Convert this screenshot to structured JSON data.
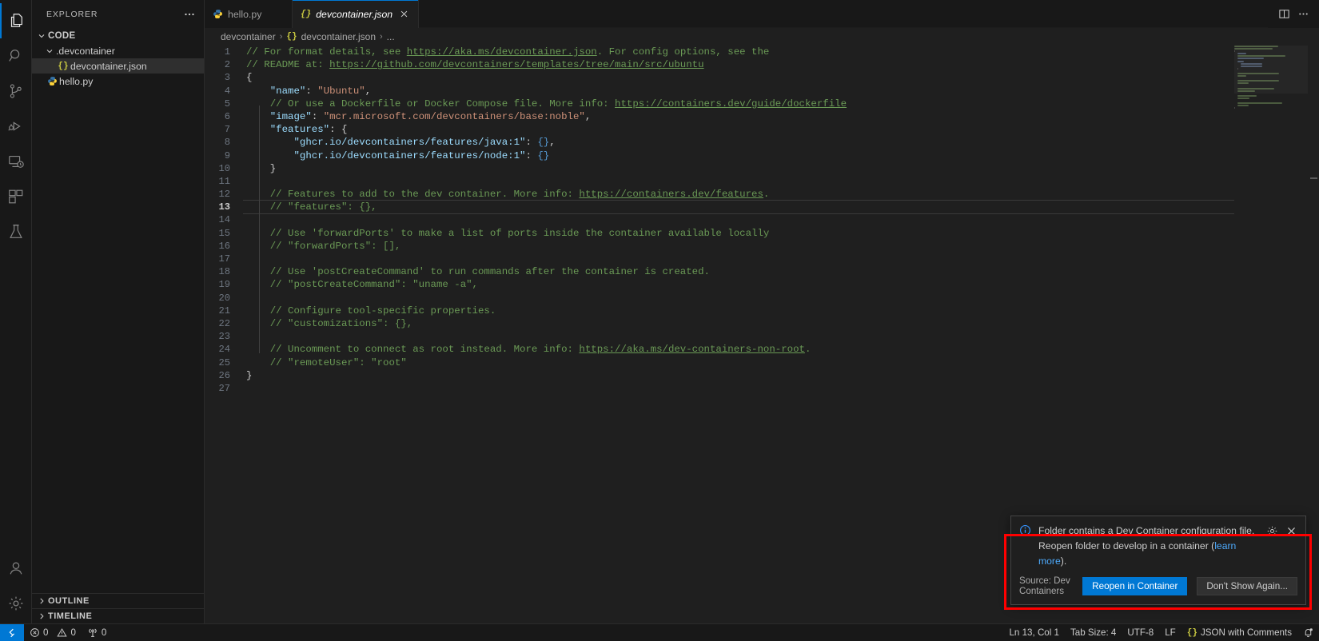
{
  "activitybar": {
    "items": [
      {
        "name": "explorer",
        "icon": "files-icon",
        "active": true
      },
      {
        "name": "search",
        "icon": "search-icon",
        "active": false
      },
      {
        "name": "source-control",
        "icon": "source-control-icon",
        "active": false
      },
      {
        "name": "run-and-debug",
        "icon": "run-debug-icon",
        "active": false
      },
      {
        "name": "remote-explorer",
        "icon": "remote-explorer-icon",
        "active": false
      },
      {
        "name": "extensions",
        "icon": "extensions-icon",
        "active": false
      },
      {
        "name": "testing",
        "icon": "testing-flask-icon",
        "active": false
      }
    ],
    "bottom": [
      {
        "name": "accounts",
        "icon": "account-icon"
      },
      {
        "name": "manage",
        "icon": "gear-icon"
      }
    ]
  },
  "sidebar": {
    "title": "EXPLORER",
    "actions": [
      "more-actions-icon"
    ],
    "tree": [
      {
        "label": "CODE",
        "level": 0,
        "kind": "folder-root",
        "expanded": true,
        "selected": false
      },
      {
        "label": ".devcontainer",
        "level": 1,
        "kind": "folder",
        "expanded": true,
        "selected": false
      },
      {
        "label": "devcontainer.json",
        "level": 2,
        "kind": "json",
        "expanded": null,
        "selected": true
      },
      {
        "label": "hello.py",
        "level": 1,
        "kind": "python",
        "expanded": null,
        "selected": false
      }
    ],
    "panels": [
      {
        "label": "OUTLINE",
        "expanded": false
      },
      {
        "label": "TIMELINE",
        "expanded": false
      }
    ]
  },
  "tabs": [
    {
      "label": "hello.py",
      "icon": "python-icon",
      "active": false,
      "closable": false
    },
    {
      "label": "devcontainer.json",
      "icon": "json-icon",
      "active": true,
      "closable": true
    }
  ],
  "editor_actions": [
    {
      "name": "split-editor-right",
      "icon": "split-editor-icon"
    },
    {
      "name": "more-editor-actions",
      "icon": "ellipsis-icon"
    }
  ],
  "breadcrumbs": [
    "devcontainer",
    "devcontainer.json",
    "..."
  ],
  "editor": {
    "current_line": 13,
    "total_lines": 27,
    "lines": [
      {
        "n": 1,
        "indent": 0,
        "segs": [
          {
            "t": "// For format details, see ",
            "c": "cmt"
          },
          {
            "t": "https://aka.ms/devcontainer.json",
            "c": "lnk"
          },
          {
            "t": ". For config options, see the",
            "c": "cmt"
          }
        ]
      },
      {
        "n": 2,
        "indent": 0,
        "segs": [
          {
            "t": "// README at: ",
            "c": "cmt"
          },
          {
            "t": "https://github.com/devcontainers/templates/tree/main/src/ubuntu",
            "c": "lnk"
          }
        ]
      },
      {
        "n": 3,
        "indent": 0,
        "segs": [
          {
            "t": "{",
            "c": "brc"
          }
        ]
      },
      {
        "n": 4,
        "indent": 1,
        "segs": [
          {
            "t": "\"name\"",
            "c": "key"
          },
          {
            "t": ": ",
            "c": "pun"
          },
          {
            "t": "\"Ubuntu\"",
            "c": "str"
          },
          {
            "t": ",",
            "c": "pun"
          }
        ]
      },
      {
        "n": 5,
        "indent": 1,
        "segs": [
          {
            "t": "// Or use a Dockerfile or Docker Compose file. More info: ",
            "c": "cmt"
          },
          {
            "t": "https://containers.dev/guide/dockerfile",
            "c": "lnk"
          }
        ]
      },
      {
        "n": 6,
        "indent": 1,
        "segs": [
          {
            "t": "\"image\"",
            "c": "key"
          },
          {
            "t": ": ",
            "c": "pun"
          },
          {
            "t": "\"mcr.microsoft.com/devcontainers/base:noble\"",
            "c": "str"
          },
          {
            "t": ",",
            "c": "pun"
          }
        ]
      },
      {
        "n": 7,
        "indent": 1,
        "segs": [
          {
            "t": "\"features\"",
            "c": "key"
          },
          {
            "t": ": {",
            "c": "pun"
          }
        ]
      },
      {
        "n": 8,
        "indent": 2,
        "segs": [
          {
            "t": "\"ghcr.io/devcontainers/features/java:1\"",
            "c": "key"
          },
          {
            "t": ": ",
            "c": "pun"
          },
          {
            "t": "{}",
            "c": "cbrace-blue"
          },
          {
            "t": ",",
            "c": "pun"
          }
        ]
      },
      {
        "n": 9,
        "indent": 2,
        "segs": [
          {
            "t": "\"ghcr.io/devcontainers/features/node:1\"",
            "c": "key"
          },
          {
            "t": ": ",
            "c": "pun"
          },
          {
            "t": "{}",
            "c": "cbrace-blue"
          }
        ]
      },
      {
        "n": 10,
        "indent": 1,
        "segs": [
          {
            "t": "}",
            "c": "pun"
          }
        ]
      },
      {
        "n": 11,
        "indent": 0,
        "segs": []
      },
      {
        "n": 12,
        "indent": 1,
        "segs": [
          {
            "t": "// Features to add to the dev container. More info: ",
            "c": "cmt"
          },
          {
            "t": "https://containers.dev/features",
            "c": "lnk"
          },
          {
            "t": ".",
            "c": "cmt"
          }
        ]
      },
      {
        "n": 13,
        "indent": 1,
        "segs": [
          {
            "t": "// \"features\": {},",
            "c": "cmt"
          }
        ]
      },
      {
        "n": 14,
        "indent": 0,
        "segs": []
      },
      {
        "n": 15,
        "indent": 1,
        "segs": [
          {
            "t": "// Use 'forwardPorts' to make a list of ports inside the container available locally",
            "c": "cmt"
          }
        ]
      },
      {
        "n": 16,
        "indent": 1,
        "segs": [
          {
            "t": "// \"forwardPorts\": [],",
            "c": "cmt"
          }
        ]
      },
      {
        "n": 17,
        "indent": 0,
        "segs": []
      },
      {
        "n": 18,
        "indent": 1,
        "segs": [
          {
            "t": "// Use 'postCreateCommand' to run commands after the container is created.",
            "c": "cmt"
          }
        ]
      },
      {
        "n": 19,
        "indent": 1,
        "segs": [
          {
            "t": "// \"postCreateCommand\": \"uname -a\",",
            "c": "cmt"
          }
        ]
      },
      {
        "n": 20,
        "indent": 0,
        "segs": []
      },
      {
        "n": 21,
        "indent": 1,
        "segs": [
          {
            "t": "// Configure tool-specific properties.",
            "c": "cmt"
          }
        ]
      },
      {
        "n": 22,
        "indent": 1,
        "segs": [
          {
            "t": "// \"customizations\": {},",
            "c": "cmt"
          }
        ]
      },
      {
        "n": 23,
        "indent": 0,
        "segs": []
      },
      {
        "n": 24,
        "indent": 1,
        "segs": [
          {
            "t": "// Uncomment to connect as root instead. More info: ",
            "c": "cmt"
          },
          {
            "t": "https://aka.ms/dev-containers-non-root",
            "c": "lnk"
          },
          {
            "t": ".",
            "c": "cmt"
          }
        ]
      },
      {
        "n": 25,
        "indent": 1,
        "segs": [
          {
            "t": "// \"remoteUser\": \"root\"",
            "c": "cmt"
          }
        ]
      },
      {
        "n": 26,
        "indent": 0,
        "segs": [
          {
            "t": "}",
            "c": "brc"
          }
        ]
      },
      {
        "n": 27,
        "indent": 0,
        "segs": []
      }
    ]
  },
  "notification": {
    "icon": "info-icon",
    "message_part1": "Folder contains a Dev Container configuration file. Reopen folder to develop in a container (",
    "link": "learn more",
    "message_part2": ").",
    "source": "Source: Dev Containers",
    "primary_button": "Reopen in Container",
    "secondary_button": "Don't Show Again...",
    "tools": [
      {
        "name": "configure-notification-gear-icon"
      },
      {
        "name": "close-notification-icon"
      }
    ],
    "highlight_color": "#ff0000"
  },
  "statusbar": {
    "remote_label": "",
    "left": [
      {
        "name": "problems-errors",
        "icon": "error-circle-icon",
        "value": "0"
      },
      {
        "name": "problems-warnings",
        "icon": "warning-triangle-icon",
        "value": "0"
      },
      {
        "name": "ports",
        "icon": "radio-tower-icon",
        "value": "0"
      }
    ],
    "right": [
      {
        "name": "editor-position",
        "label": "Ln 13, Col 1"
      },
      {
        "name": "editor-indentation",
        "label": "Tab Size: 4"
      },
      {
        "name": "editor-encoding",
        "label": "UTF-8"
      },
      {
        "name": "editor-eol",
        "label": "LF"
      },
      {
        "name": "editor-language",
        "label": "JSON with Comments",
        "icon": "json-icon"
      },
      {
        "name": "notifications-bell",
        "label": ""
      }
    ]
  },
  "colors": {
    "accent": "#0078d4",
    "editor_bg": "#1f1f1f",
    "chrome_bg": "#181818",
    "comment": "#6a9955",
    "string": "#ce9178",
    "property": "#9cdcfe"
  }
}
